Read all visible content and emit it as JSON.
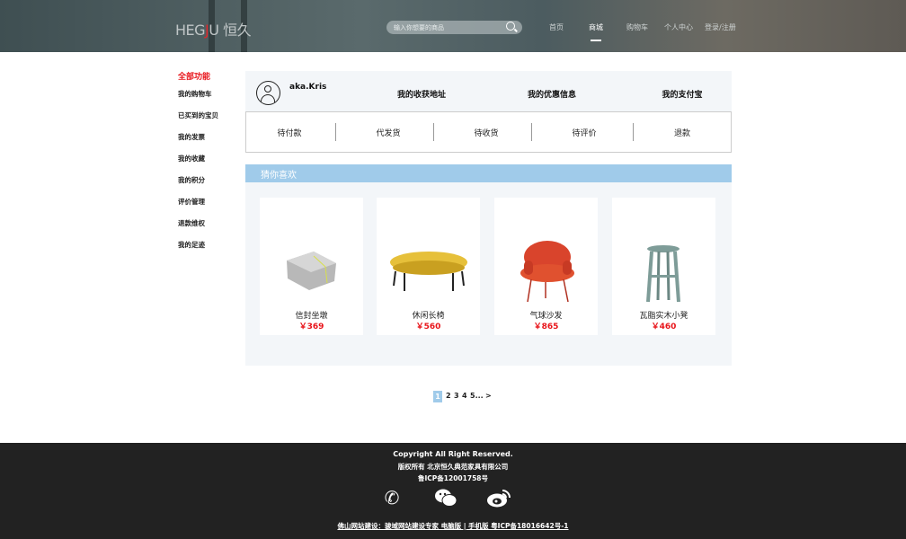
{
  "header": {
    "logo": {
      "latin_a": "HEG",
      "latin_j": "J",
      "latin_b": "U",
      "cn": "恒久"
    },
    "search_placeholder": "输入你想要的商品",
    "nav": [
      "首页",
      "商城",
      "购物车",
      "个人中心",
      "登录/注册"
    ],
    "active_nav": "商城"
  },
  "sidebar": {
    "title": "全部功能",
    "items": [
      "我的购物车",
      "已买到的宝贝",
      "我的发票",
      "我的收藏",
      "我的积分",
      "评价管理",
      "退款维权",
      "我的足迹"
    ]
  },
  "user": {
    "name": "aka.Kris",
    "links": [
      "我的收获地址",
      "我的优惠信息",
      "我的支付宝"
    ]
  },
  "orders": [
    "待付款",
    "代发货",
    "待收货",
    "待评价",
    "退款"
  ],
  "guess": {
    "title": "猜你喜欢",
    "products": [
      {
        "name": "信封坐墩",
        "price": "￥369"
      },
      {
        "name": "休闲长椅",
        "price": "￥560"
      },
      {
        "name": "气球沙发",
        "price": "￥865"
      },
      {
        "name": "瓦脂实木小凳",
        "price": "￥460"
      }
    ]
  },
  "pagination": {
    "current": "1",
    "pages": [
      "2",
      "3",
      "4",
      "5..."
    ],
    "next": ">"
  },
  "footer": {
    "copyright": "Copyright All Right Reserved.",
    "company": "版权所有 北京恒久典范家具有限公司",
    "icp": "鲁ICP备12001758号",
    "bottom": "佛山网站建设：骏域网站建设专家  电脑版 | 手机版  粤ICP备18016642号-1"
  },
  "colors": {
    "accent": "#a0cbea",
    "price": "#e8141a",
    "footer_bg": "#222222"
  }
}
